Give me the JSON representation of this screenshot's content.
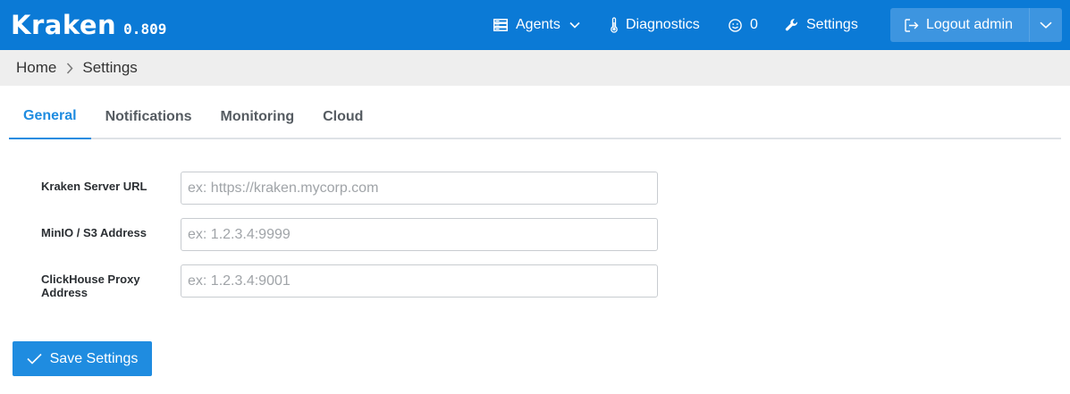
{
  "app": {
    "name": "Kraken",
    "version": "0.809"
  },
  "nav": {
    "agents_label": "Agents",
    "diagnostics_label": "Diagnostics",
    "smiley_count": "0",
    "settings_label": "Settings",
    "logout_label": "Logout admin"
  },
  "breadcrumb": {
    "home": "Home",
    "current": "Settings"
  },
  "tabs": [
    {
      "label": "General",
      "active": true
    },
    {
      "label": "Notifications",
      "active": false
    },
    {
      "label": "Monitoring",
      "active": false
    },
    {
      "label": "Cloud",
      "active": false
    }
  ],
  "form": {
    "fields": [
      {
        "label": "Kraken Server URL",
        "value": "",
        "placeholder": "ex: https://kraken.mycorp.com"
      },
      {
        "label": "MinIO / S3 Address",
        "value": "",
        "placeholder": "ex: 1.2.3.4:9999"
      },
      {
        "label": "ClickHouse Proxy Address",
        "value": "",
        "placeholder": "ex: 1.2.3.4:9001"
      }
    ],
    "save_label": "Save Settings"
  },
  "icons": {
    "agents": "server-icon",
    "diagnostics": "thermometer-icon",
    "smiley": "smiley-icon",
    "settings": "wrench-icon",
    "logout": "sign-out-icon",
    "save": "check-icon"
  },
  "colors": {
    "navbar": "#0b7ad6",
    "logout_button": "#3d95e0",
    "accent": "#1f8ce0",
    "breadcrumb_bg": "#eeeeee"
  }
}
